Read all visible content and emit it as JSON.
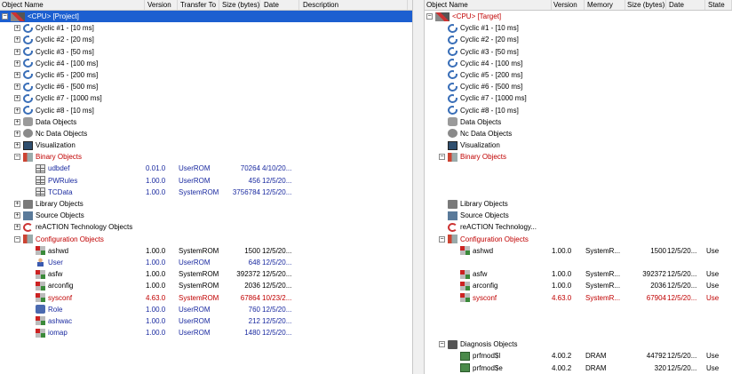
{
  "left": {
    "headers": [
      "Object Name",
      "Version",
      "Transfer To",
      "Size (bytes)",
      "Date",
      "Description"
    ],
    "rows": [
      {
        "name": "<CPU> [Project]",
        "icon": "cpu-icon",
        "indent": 0,
        "expander": "−",
        "color": "sel",
        "version": "",
        "transfer": "",
        "size": "",
        "date": ""
      },
      {
        "name": "Cyclic #1 - [10 ms]",
        "icon": "cyclic-icon",
        "indent": 1,
        "expander": "+",
        "color": "",
        "version": "",
        "transfer": "",
        "size": "",
        "date": ""
      },
      {
        "name": "Cyclic #2 - [20 ms]",
        "icon": "cyclic-icon",
        "indent": 1,
        "expander": "+",
        "color": "",
        "version": "",
        "transfer": "",
        "size": "",
        "date": ""
      },
      {
        "name": "Cyclic #3 - [50 ms]",
        "icon": "cyclic-icon",
        "indent": 1,
        "expander": "+",
        "color": "",
        "version": "",
        "transfer": "",
        "size": "",
        "date": ""
      },
      {
        "name": "Cyclic #4 - [100 ms]",
        "icon": "cyclic-icon",
        "indent": 1,
        "expander": "+",
        "color": "",
        "version": "",
        "transfer": "",
        "size": "",
        "date": ""
      },
      {
        "name": "Cyclic #5 - [200 ms]",
        "icon": "cyclic-icon",
        "indent": 1,
        "expander": "+",
        "color": "",
        "version": "",
        "transfer": "",
        "size": "",
        "date": ""
      },
      {
        "name": "Cyclic #6 - [500 ms]",
        "icon": "cyclic-icon",
        "indent": 1,
        "expander": "+",
        "color": "",
        "version": "",
        "transfer": "",
        "size": "",
        "date": ""
      },
      {
        "name": "Cyclic #7 - [1000 ms]",
        "icon": "cyclic-icon",
        "indent": 1,
        "expander": "+",
        "color": "",
        "version": "",
        "transfer": "",
        "size": "",
        "date": ""
      },
      {
        "name": "Cyclic #8 - [10 ms]",
        "icon": "cyclic-icon",
        "indent": 1,
        "expander": "+",
        "color": "",
        "version": "",
        "transfer": "",
        "size": "",
        "date": ""
      },
      {
        "name": "Data Objects",
        "icon": "database-icon",
        "indent": 1,
        "expander": "+",
        "color": "",
        "version": "",
        "transfer": "",
        "size": "",
        "date": ""
      },
      {
        "name": "Nc Data Objects",
        "icon": "gear-icon",
        "indent": 1,
        "expander": "+",
        "color": "",
        "version": "",
        "transfer": "",
        "size": "",
        "date": ""
      },
      {
        "name": "Visualization",
        "icon": "monitor-icon",
        "indent": 1,
        "expander": "+",
        "color": "",
        "version": "",
        "transfer": "",
        "size": "",
        "date": ""
      },
      {
        "name": "Binary Objects",
        "icon": "binary-folder-icon",
        "indent": 1,
        "expander": "−",
        "color": "red",
        "version": "",
        "transfer": "",
        "size": "",
        "date": ""
      },
      {
        "name": "udbdef",
        "icon": "grid-icon",
        "indent": 2,
        "expander": "",
        "color": "blue",
        "version": "0.01.0",
        "transfer": "UserROM",
        "size": "70264",
        "date": "4/10/20..."
      },
      {
        "name": "PWRules",
        "icon": "grid-icon",
        "indent": 2,
        "expander": "",
        "color": "blue",
        "version": "1.00.0",
        "transfer": "UserROM",
        "size": "456",
        "date": "12/5/20..."
      },
      {
        "name": "TCData",
        "icon": "grid-icon",
        "indent": 2,
        "expander": "",
        "color": "blue",
        "version": "1.00.0",
        "transfer": "SystemROM",
        "size": "3756784",
        "date": "12/5/20..."
      },
      {
        "name": "Library Objects",
        "icon": "library-icon",
        "indent": 1,
        "expander": "+",
        "color": "",
        "version": "",
        "transfer": "",
        "size": "",
        "date": ""
      },
      {
        "name": "Source Objects",
        "icon": "source-icon",
        "indent": 1,
        "expander": "+",
        "color": "",
        "version": "",
        "transfer": "",
        "size": "",
        "date": ""
      },
      {
        "name": "reACTION Technology Objects",
        "icon": "reaction-icon",
        "indent": 1,
        "expander": "+",
        "color": "",
        "version": "",
        "transfer": "",
        "size": "",
        "date": ""
      },
      {
        "name": "Configuration Objects",
        "icon": "config-folder-icon",
        "indent": 1,
        "expander": "−",
        "color": "red",
        "version": "",
        "transfer": "",
        "size": "",
        "date": ""
      },
      {
        "name": "ashwd",
        "icon": "config-grid-icon",
        "indent": 2,
        "expander": "",
        "color": "",
        "version": "1.00.0",
        "transfer": "SystemROM",
        "size": "1500",
        "date": "12/5/20..."
      },
      {
        "name": "User",
        "icon": "user-icon",
        "indent": 2,
        "expander": "",
        "color": "blue",
        "version": "1.00.0",
        "transfer": "UserROM",
        "size": "648",
        "date": "12/5/20..."
      },
      {
        "name": "asfw",
        "icon": "config-grid-icon",
        "indent": 2,
        "expander": "",
        "color": "",
        "version": "1.00.0",
        "transfer": "SystemROM",
        "size": "392372",
        "date": "12/5/20..."
      },
      {
        "name": "arconfig",
        "icon": "config-grid-icon",
        "indent": 2,
        "expander": "",
        "color": "",
        "version": "1.00.0",
        "transfer": "SystemROM",
        "size": "2036",
        "date": "12/5/20..."
      },
      {
        "name": "sysconf",
        "icon": "config-grid-icon",
        "indent": 2,
        "expander": "",
        "color": "red",
        "version": "4.63.0",
        "transfer": "SystemROM",
        "size": "67864",
        "date": "10/23/2..."
      },
      {
        "name": "Role",
        "icon": "role-icon",
        "indent": 2,
        "expander": "",
        "color": "blue",
        "version": "1.00.0",
        "transfer": "UserROM",
        "size": "760",
        "date": "12/5/20..."
      },
      {
        "name": "ashwac",
        "icon": "config-grid-icon",
        "indent": 2,
        "expander": "",
        "color": "blue",
        "version": "1.00.0",
        "transfer": "UserROM",
        "size": "212",
        "date": "12/5/20..."
      },
      {
        "name": "iomap",
        "icon": "config-grid-icon",
        "indent": 2,
        "expander": "",
        "color": "blue",
        "version": "1.00.0",
        "transfer": "UserROM",
        "size": "1480",
        "date": "12/5/20..."
      }
    ]
  },
  "right": {
    "headers": [
      "Object Name",
      "Version",
      "Memory",
      "Size (bytes)",
      "Date",
      "State"
    ],
    "rows": [
      {
        "name": "<CPU> [Target]",
        "icon": "cpu-icon",
        "indent": 0,
        "expander": "−",
        "color": "red",
        "version": "",
        "memory": "",
        "size": "",
        "date": "",
        "state": ""
      },
      {
        "name": "Cyclic #1 - [10 ms]",
        "icon": "cyclic-icon",
        "indent": 1,
        "expander": "",
        "color": "",
        "version": "",
        "memory": "",
        "size": "",
        "date": "",
        "state": ""
      },
      {
        "name": "Cyclic #2 - [20 ms]",
        "icon": "cyclic-icon",
        "indent": 1,
        "expander": "",
        "color": "",
        "version": "",
        "memory": "",
        "size": "",
        "date": "",
        "state": ""
      },
      {
        "name": "Cyclic #3 - [50 ms]",
        "icon": "cyclic-icon",
        "indent": 1,
        "expander": "",
        "color": "",
        "version": "",
        "memory": "",
        "size": "",
        "date": "",
        "state": ""
      },
      {
        "name": "Cyclic #4 - [100 ms]",
        "icon": "cyclic-icon",
        "indent": 1,
        "expander": "",
        "color": "",
        "version": "",
        "memory": "",
        "size": "",
        "date": "",
        "state": ""
      },
      {
        "name": "Cyclic #5 - [200 ms]",
        "icon": "cyclic-icon",
        "indent": 1,
        "expander": "",
        "color": "",
        "version": "",
        "memory": "",
        "size": "",
        "date": "",
        "state": ""
      },
      {
        "name": "Cyclic #6 - [500 ms]",
        "icon": "cyclic-icon",
        "indent": 1,
        "expander": "",
        "color": "",
        "version": "",
        "memory": "",
        "size": "",
        "date": "",
        "state": ""
      },
      {
        "name": "Cyclic #7 - [1000 ms]",
        "icon": "cyclic-icon",
        "indent": 1,
        "expander": "",
        "color": "",
        "version": "",
        "memory": "",
        "size": "",
        "date": "",
        "state": ""
      },
      {
        "name": "Cyclic #8 - [10 ms]",
        "icon": "cyclic-icon",
        "indent": 1,
        "expander": "",
        "color": "",
        "version": "",
        "memory": "",
        "size": "",
        "date": "",
        "state": ""
      },
      {
        "name": "Data Objects",
        "icon": "database-icon",
        "indent": 1,
        "expander": "",
        "color": "",
        "version": "",
        "memory": "",
        "size": "",
        "date": "",
        "state": ""
      },
      {
        "name": "Nc Data Objects",
        "icon": "gear-icon",
        "indent": 1,
        "expander": "",
        "color": "",
        "version": "",
        "memory": "",
        "size": "",
        "date": "",
        "state": ""
      },
      {
        "name": "Visualization",
        "icon": "monitor-icon",
        "indent": 1,
        "expander": "",
        "color": "",
        "version": "",
        "memory": "",
        "size": "",
        "date": "",
        "state": ""
      },
      {
        "name": "Binary Objects",
        "icon": "binary-folder-icon",
        "indent": 1,
        "expander": "−",
        "color": "red",
        "version": "",
        "memory": "",
        "size": "",
        "date": "",
        "state": ""
      },
      {
        "name": "",
        "icon": "",
        "indent": 2,
        "expander": "",
        "color": "",
        "version": "",
        "memory": "",
        "size": "",
        "date": "",
        "state": ""
      },
      {
        "name": "",
        "icon": "",
        "indent": 2,
        "expander": "",
        "color": "",
        "version": "",
        "memory": "",
        "size": "",
        "date": "",
        "state": ""
      },
      {
        "name": "",
        "icon": "",
        "indent": 2,
        "expander": "",
        "color": "",
        "version": "",
        "memory": "",
        "size": "",
        "date": "",
        "state": ""
      },
      {
        "name": "Library Objects",
        "icon": "library-icon",
        "indent": 1,
        "expander": "",
        "color": "",
        "version": "",
        "memory": "",
        "size": "",
        "date": "",
        "state": ""
      },
      {
        "name": "Source Objects",
        "icon": "source-icon",
        "indent": 1,
        "expander": "",
        "color": "",
        "version": "",
        "memory": "",
        "size": "",
        "date": "",
        "state": ""
      },
      {
        "name": "reACTION Technology...",
        "icon": "reaction-icon",
        "indent": 1,
        "expander": "",
        "color": "",
        "version": "",
        "memory": "",
        "size": "",
        "date": "",
        "state": ""
      },
      {
        "name": "Configuration Objects",
        "icon": "config-folder-icon",
        "indent": 1,
        "expander": "−",
        "color": "red",
        "version": "",
        "memory": "",
        "size": "",
        "date": "",
        "state": ""
      },
      {
        "name": "ashwd",
        "icon": "config-grid-icon",
        "indent": 2,
        "expander": "",
        "color": "",
        "version": "1.00.0",
        "memory": "SystemR...",
        "size": "1500",
        "date": "12/5/20...",
        "state": "Use"
      },
      {
        "name": "",
        "icon": "",
        "indent": 2,
        "expander": "",
        "color": "",
        "version": "",
        "memory": "",
        "size": "",
        "date": "",
        "state": ""
      },
      {
        "name": "asfw",
        "icon": "config-grid-icon",
        "indent": 2,
        "expander": "",
        "color": "",
        "version": "1.00.0",
        "memory": "SystemR...",
        "size": "392372",
        "date": "12/5/20...",
        "state": "Use"
      },
      {
        "name": "arconfig",
        "icon": "config-grid-icon",
        "indent": 2,
        "expander": "",
        "color": "",
        "version": "1.00.0",
        "memory": "SystemR...",
        "size": "2036",
        "date": "12/5/20...",
        "state": "Use"
      },
      {
        "name": "sysconf",
        "icon": "config-grid-icon",
        "indent": 2,
        "expander": "",
        "color": "red",
        "version": "4.63.0",
        "memory": "SystemR...",
        "size": "67904",
        "date": "12/5/20...",
        "state": "Use"
      },
      {
        "name": "",
        "icon": "",
        "indent": 2,
        "expander": "",
        "color": "",
        "version": "",
        "memory": "",
        "size": "",
        "date": "",
        "state": ""
      },
      {
        "name": "",
        "icon": "",
        "indent": 2,
        "expander": "",
        "color": "",
        "version": "",
        "memory": "",
        "size": "",
        "date": "",
        "state": ""
      },
      {
        "name": "",
        "icon": "",
        "indent": 2,
        "expander": "",
        "color": "",
        "version": "",
        "memory": "",
        "size": "",
        "date": "",
        "state": ""
      },
      {
        "name": "Diagnosis Objects",
        "icon": "diagnosis-icon",
        "indent": 1,
        "expander": "−",
        "color": "",
        "version": "",
        "memory": "",
        "size": "",
        "date": "",
        "state": ""
      },
      {
        "name": "prfmod$l",
        "icon": "module-icon",
        "indent": 2,
        "expander": "",
        "color": "",
        "version": "4.00.2",
        "memory": "DRAM",
        "size": "44792",
        "date": "12/5/20...",
        "state": "Use"
      },
      {
        "name": "prfmod$e",
        "icon": "module-icon",
        "indent": 2,
        "expander": "",
        "color": "",
        "version": "4.00.2",
        "memory": "DRAM",
        "size": "320",
        "date": "12/5/20...",
        "state": "Use"
      }
    ]
  }
}
